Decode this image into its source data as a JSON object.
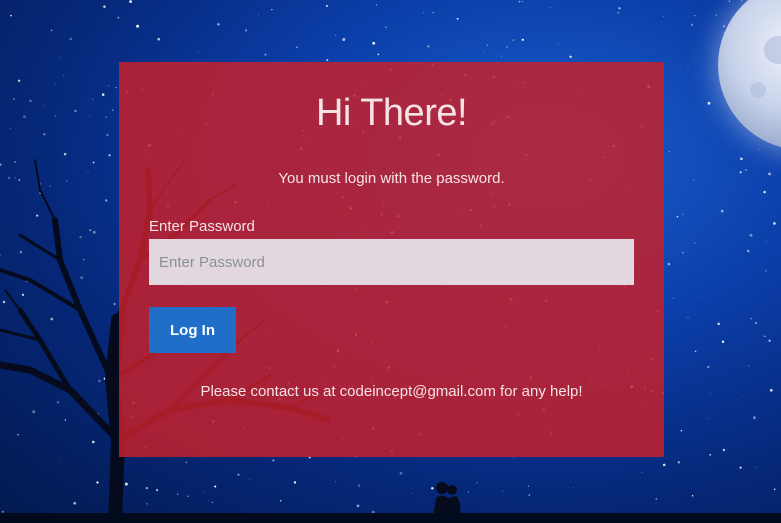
{
  "login": {
    "title": "Hi There!",
    "subtitle": "You must login with the password.",
    "password_label": "Enter Password",
    "password_placeholder": "Enter Password",
    "password_value": "",
    "login_button": "Log In",
    "help_text": "Please contact us at codeincept@gmail.com for any help!"
  },
  "colors": {
    "card_background": "#c8202a",
    "button": "#1f6fc8",
    "sky": "#0b3ea8"
  },
  "icons": [
    "moon",
    "tree-silhouette",
    "couple-silhouette",
    "star-field"
  ]
}
